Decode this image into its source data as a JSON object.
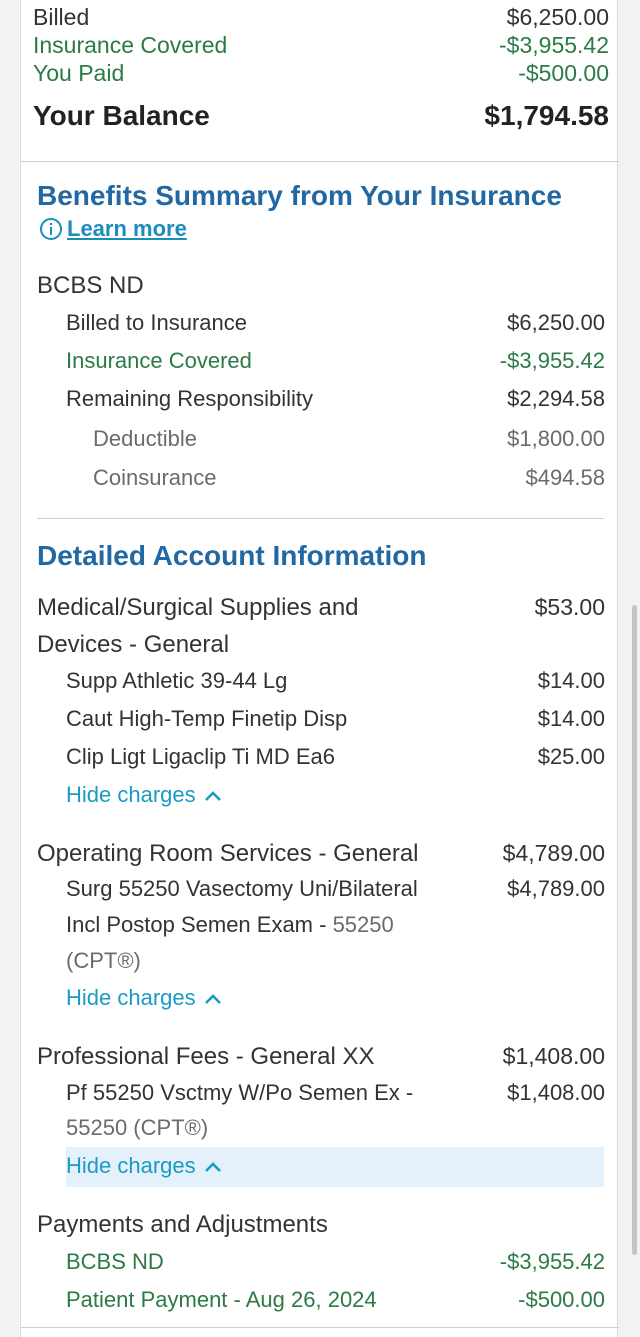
{
  "summary": {
    "billed_label": "Billed",
    "billed_value": "$6,250.00",
    "insurance_covered_label": "Insurance Covered",
    "insurance_covered_value": "-$3,955.42",
    "you_paid_label": "You Paid",
    "you_paid_value": "-$500.00",
    "balance_label": "Your Balance",
    "balance_value": "$1,794.58"
  },
  "benefits": {
    "title": "Benefits Summary from Your Insurance",
    "learn_more": "Learn more",
    "insurer": "BCBS ND",
    "billed_to_insurance_label": "Billed to Insurance",
    "billed_to_insurance_value": "$6,250.00",
    "insurance_covered_label": "Insurance Covered",
    "insurance_covered_value": "-$3,955.42",
    "remaining_label": "Remaining Responsibility",
    "remaining_value": "$2,294.58",
    "deductible_label": "Deductible",
    "deductible_value": "$1,800.00",
    "coinsurance_label": "Coinsurance",
    "coinsurance_value": "$494.58"
  },
  "detailed": {
    "title": "Detailed Account Information",
    "hide_charges_label": "Hide charges",
    "groups": [
      {
        "title_line1": "Medical/Surgical Supplies and",
        "title_line2": "Devices - General",
        "total": "$53.00",
        "items": [
          {
            "label": "Supp Athletic 39-44 Lg",
            "value": "$14.00"
          },
          {
            "label": "Caut High-Temp Finetip Disp",
            "value": "$14.00"
          },
          {
            "label": "Clip Ligt Ligaclip Ti MD Ea6",
            "value": "$25.00"
          }
        ]
      },
      {
        "title": "Operating Room Services - General",
        "total": "$4,789.00",
        "item_line1": "Surg 55250 Vasectomy Uni/Bilateral",
        "item_line2": "Incl Postop Semen Exam - ",
        "item_code": "55250",
        "item_line3": "(CPT®)",
        "item_value": "$4,789.00"
      },
      {
        "title": "Professional Fees - General XX",
        "total": "$1,408.00",
        "item_line1": "Pf 55250 Vsctmy W/Po Semen Ex -",
        "item_line2": "55250 (CPT®)",
        "item_value": "$1,408.00"
      }
    ]
  },
  "payments": {
    "title": "Payments and Adjustments",
    "items": [
      {
        "label": "BCBS ND",
        "value": "-$3,955.42"
      },
      {
        "label": "Patient Payment - Aug 26, 2024",
        "value": "-$500.00"
      }
    ]
  },
  "colors": {
    "green": "#2c7a46",
    "heading_blue": "#2268a3",
    "link_blue": "#1a9bc4",
    "highlight": "#e4f1fb"
  }
}
